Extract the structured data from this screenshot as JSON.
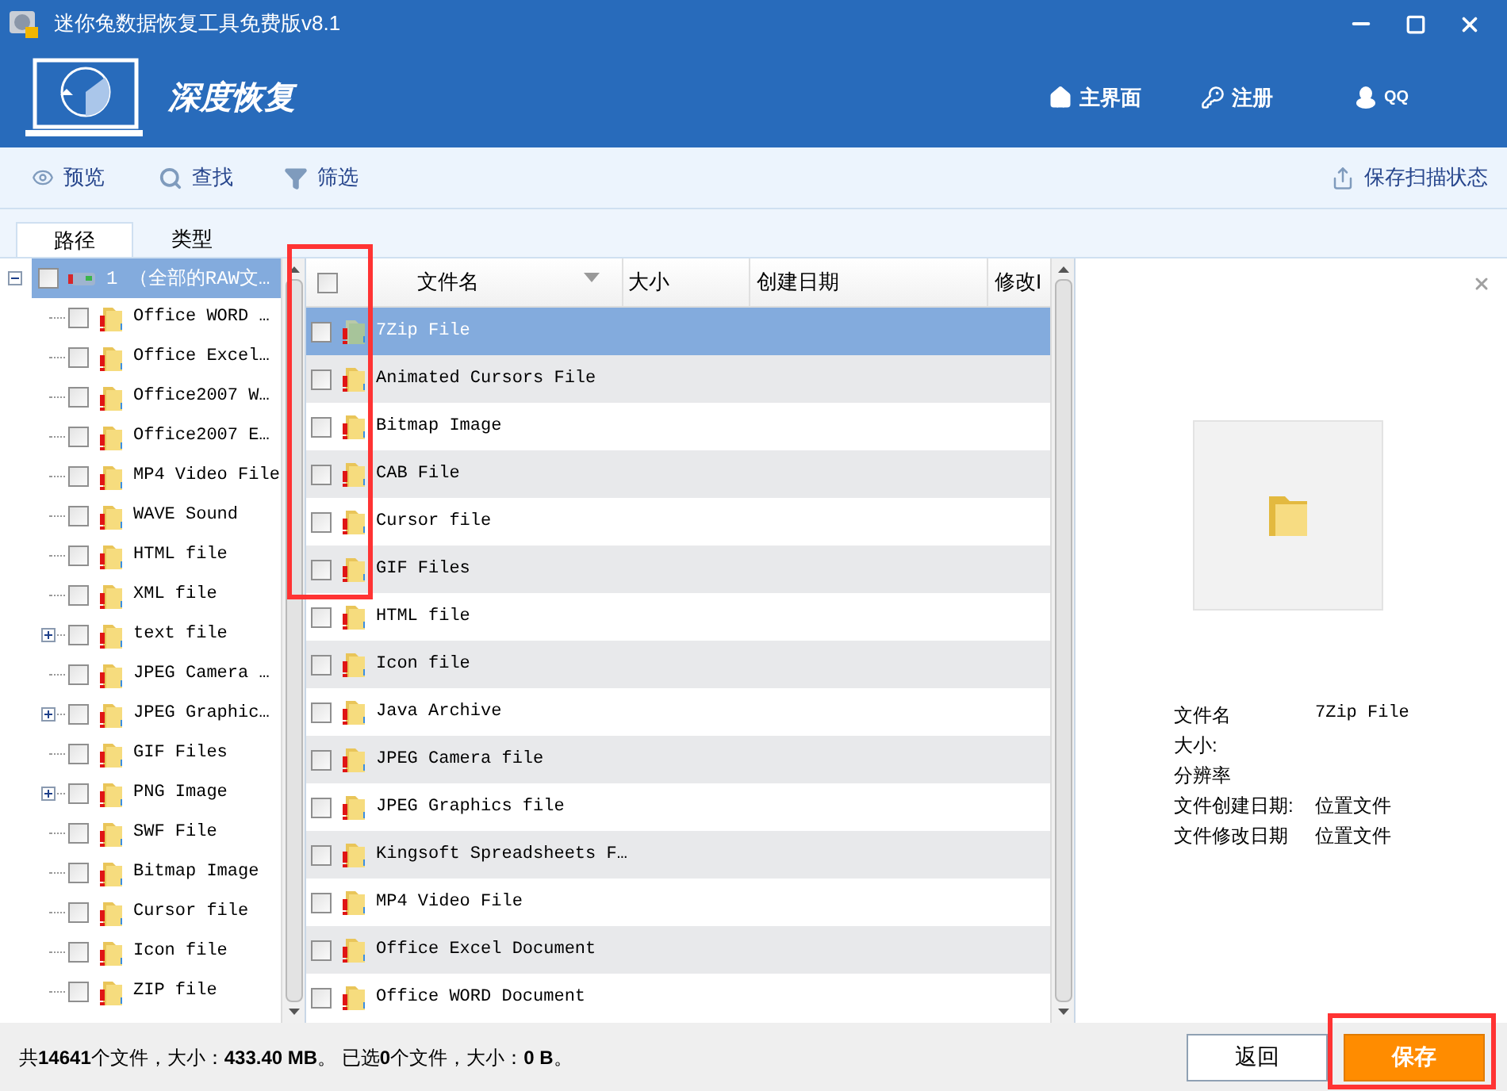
{
  "window": {
    "title": "迷你兔数据恢复工具免费版v8.1"
  },
  "header": {
    "mode_title": "深度恢复",
    "nav": [
      "主界面",
      "注册",
      "QQ"
    ]
  },
  "toolbar": {
    "items": [
      "预览",
      "查找",
      "筛选"
    ],
    "save_scan": "保存扫描状态"
  },
  "tabs": [
    {
      "label": "路径",
      "selected": true
    },
    {
      "label": "类型",
      "selected": false
    }
  ],
  "tree": {
    "root": {
      "label": "1 （全部的RAW文…",
      "selected": true,
      "checked": false,
      "expanded": true,
      "children": [
        {
          "label": "Office WORD …",
          "kind": "leaf",
          "checked": false
        },
        {
          "label": "Office Excel…",
          "kind": "leaf",
          "checked": false
        },
        {
          "label": "Office2007 W…",
          "kind": "leaf",
          "checked": false
        },
        {
          "label": "Office2007 E…",
          "kind": "leaf",
          "checked": false
        },
        {
          "label": "MP4 Video File",
          "kind": "leaf",
          "checked": false
        },
        {
          "label": "WAVE Sound",
          "kind": "leaf",
          "checked": false
        },
        {
          "label": "HTML file",
          "kind": "leaf",
          "checked": false
        },
        {
          "label": "XML file",
          "kind": "leaf",
          "checked": false
        },
        {
          "label": "text file",
          "kind": "group",
          "expanded": false,
          "checked": false
        },
        {
          "label": "JPEG Camera …",
          "kind": "leaf",
          "checked": false
        },
        {
          "label": "JPEG Graphic…",
          "kind": "group",
          "expanded": false,
          "checked": false
        },
        {
          "label": "GIF Files",
          "kind": "leaf",
          "checked": false
        },
        {
          "label": "PNG Image",
          "kind": "group",
          "expanded": false,
          "checked": false
        },
        {
          "label": "SWF File",
          "kind": "leaf",
          "checked": false
        },
        {
          "label": "Bitmap Image",
          "kind": "leaf",
          "checked": false
        },
        {
          "label": "Cursor file",
          "kind": "leaf",
          "checked": false
        },
        {
          "label": "Icon file",
          "kind": "leaf",
          "checked": false
        },
        {
          "label": "ZIP file",
          "kind": "leaf",
          "checked": false
        }
      ]
    }
  },
  "table": {
    "all_checked": false,
    "columns": [
      "文件名",
      "大小",
      "创建日期",
      "修改I"
    ],
    "rows": [
      {
        "name": "7Zip File",
        "selected": true,
        "checked": false
      },
      {
        "name": "Animated Cursors File",
        "selected": false,
        "checked": false
      },
      {
        "name": "Bitmap Image",
        "selected": false,
        "checked": false
      },
      {
        "name": "CAB File",
        "selected": false,
        "checked": false
      },
      {
        "name": "Cursor file",
        "selected": false,
        "checked": false
      },
      {
        "name": "GIF Files",
        "selected": false,
        "checked": false
      },
      {
        "name": "HTML file",
        "selected": false,
        "checked": false
      },
      {
        "name": "Icon file",
        "selected": false,
        "checked": false
      },
      {
        "name": "Java Archive",
        "selected": false,
        "checked": false
      },
      {
        "name": "JPEG Camera file",
        "selected": false,
        "checked": false
      },
      {
        "name": "JPEG Graphics file",
        "selected": false,
        "checked": false
      },
      {
        "name": "Kingsoft Spreadsheets F…",
        "selected": false,
        "checked": false
      },
      {
        "name": "MP4 Video File",
        "selected": false,
        "checked": false
      },
      {
        "name": "Office Excel Document",
        "selected": false,
        "checked": false
      },
      {
        "name": "Office WORD Document",
        "selected": false,
        "checked": false
      }
    ]
  },
  "preview": {
    "info": [
      {
        "label": "文件名",
        "value": "7Zip File"
      },
      {
        "label": "大小:"
      },
      {
        "label": "分辨率"
      },
      {
        "label": "文件创建日期:",
        "value": "位置文件"
      },
      {
        "label": "文件修改日期",
        "value": "位置文件"
      }
    ]
  },
  "status_bar": {
    "summary": "共**14641**个文件，大小：**433.40 MB**。 已选**0**个文件，大小：**0 B**。"
  },
  "buttons": [
    {
      "label": "返回",
      "kind": "secondary"
    },
    {
      "label": "保存",
      "kind": "primary"
    }
  ]
}
